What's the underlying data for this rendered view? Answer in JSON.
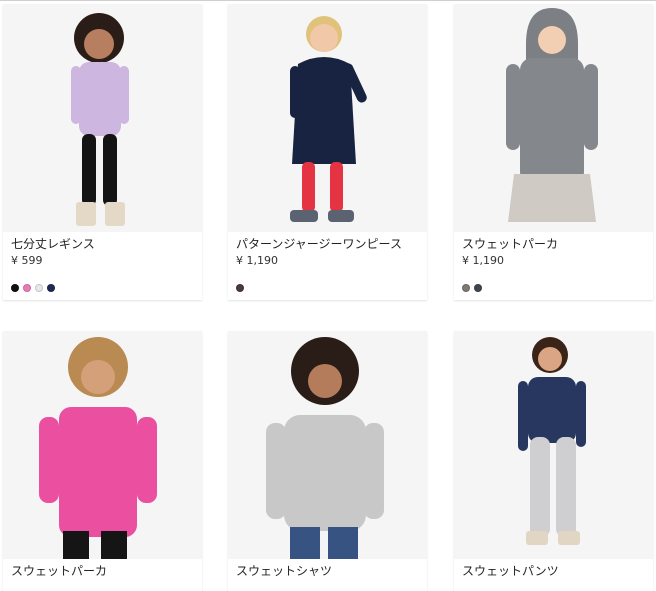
{
  "products": [
    {
      "name": "七分丈レギンス",
      "price": "¥ 599",
      "swatches": [
        "#111111",
        "#e77bb8",
        "#e8e8ec",
        "#1e2a54"
      ]
    },
    {
      "name": "パターンジャージーワンピース",
      "price": "¥ 1,190",
      "swatches": [
        "#4a3a38"
      ]
    },
    {
      "name": "スウェットパーカ",
      "price": "¥ 1,190",
      "swatches": [
        "#7b7a74",
        "#3f4550"
      ]
    },
    {
      "name": "スウェットパーカ",
      "price": "",
      "swatches": []
    },
    {
      "name": "スウェットシャツ",
      "price": "",
      "swatches": []
    },
    {
      "name": "スウェットパンツ",
      "price": "",
      "swatches": []
    }
  ]
}
